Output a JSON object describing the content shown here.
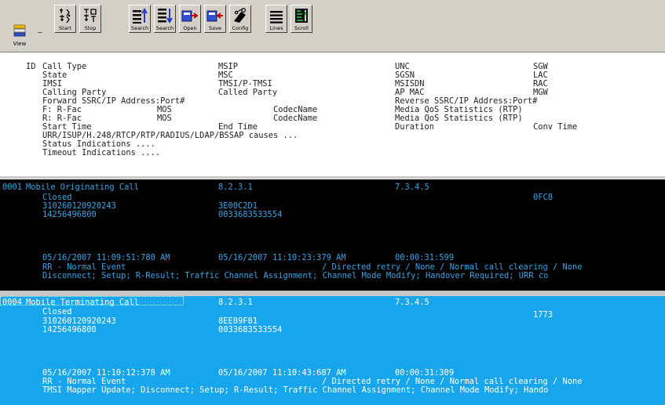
{
  "toolbar": {
    "view_label": "View",
    "buttons": [
      {
        "label": "Start",
        "icon": "start-icon"
      },
      {
        "label": "Stop",
        "icon": "stop-icon"
      },
      {
        "label": "Search",
        "icon": "search-up-icon"
      },
      {
        "label": "Search",
        "icon": "search-down-icon"
      },
      {
        "label": "Open",
        "icon": "open-icon"
      },
      {
        "label": "Save",
        "icon": "save-icon"
      },
      {
        "label": "Config",
        "icon": "config-icon"
      },
      {
        "label": "Lines",
        "icon": "lines-icon"
      },
      {
        "label": "Scroll",
        "icon": "scroll-icon"
      }
    ]
  },
  "legend": {
    "id": "ID",
    "col1": [
      "Call Type",
      "State",
      "IMSI",
      "Calling Party",
      "Forward SSRC/IP Address:Port#",
      "F: R-Fac",
      "R: R-Fac",
      "Start Time",
      "URR/ISUP/H.248/RTCP/RTP/RADIUS/LDAP/BSSAP causes ...",
      "Status Indications ....",
      "Timeout Indications ...."
    ],
    "col2": [
      "MSIP",
      "MSC",
      "TMSI/P-TMSI",
      "Called Party",
      "MOS",
      "MOS",
      "End Time"
    ],
    "col3": [
      "CodecName",
      "CodecName"
    ],
    "col4": [
      "UNC",
      "SGSN",
      "MSISDN",
      "AP MAC",
      "Reverse SSRC/IP Address:Port#",
      "Media QoS Statistics (RTP)",
      "Media QoS Statistics (RTP)",
      "Duration"
    ],
    "col5": [
      "SGW",
      "LAC",
      "RAC",
      "MGW",
      "Conv Time"
    ]
  },
  "records": [
    {
      "id": "0001",
      "call_type": "Mobile Originating Call",
      "msip": "8.2.3.1",
      "unc": "7.3.4.5",
      "state": "Closed",
      "lac": "0FC8",
      "imsi": "310260120920243",
      "tmsi": "3E00C2D1",
      "calling": "14256496800",
      "called": "0033683533554",
      "start": "05/16/2007 11:09:51:780 AM",
      "end": "05/16/2007 11:10:23:379 AM",
      "duration": "00:00:31:599",
      "causes_a": "RR - Normal Event",
      "causes_b": "/ Directed retry / None / Normal call clearing / None",
      "status": "Disconnect; Setup; R-Result; Traffic Channel Assignment; Channel Mode Modify; Handover Required; URR co"
    },
    {
      "id": "0004",
      "call_type": "Mobile Terminating Call",
      "msip": "8.2.3.1",
      "unc": "7.3.4.5",
      "state": "Closed",
      "lac": "1773",
      "imsi": "310260120920243",
      "tmsi": "8EE89F81",
      "calling": "14256496800",
      "called": "0033683533554",
      "start": "05/16/2007 11:10:12:378 AM",
      "end": "05/16/2007 11:10:43:687 AM",
      "duration": "00:00:31:309",
      "causes_a": "RR - Normal Event",
      "causes_b": "/ Directed retry / None / Normal call clearing / None",
      "status": "TMSI Mapper Update; Disconnect; Setup; R-Result; Traffic Channel Assignment; Channel Mode Modify; Hando"
    }
  ]
}
